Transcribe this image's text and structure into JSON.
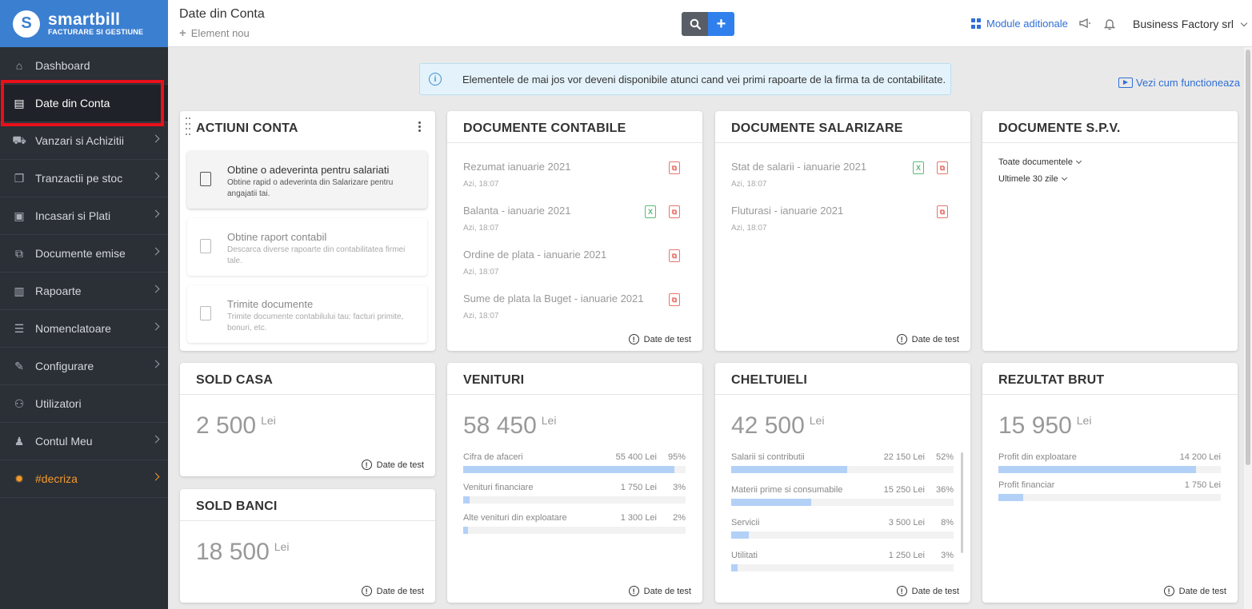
{
  "brand": {
    "name": "smartbill",
    "tagline": "FACTURARE SI GESTIUNE",
    "logo_letter": "S"
  },
  "colors": {
    "sidebar_bg": "#2b2f36",
    "brand_blue": "#3b7fd1",
    "accent": "#2f80ed",
    "highlight": "#e8101a",
    "decriza": "#f39a2b",
    "bar": "#b3d1f7"
  },
  "sidebar": {
    "items": [
      {
        "label": "Dashboard",
        "icon": "home-icon"
      },
      {
        "label": "Date din Conta",
        "icon": "book-icon",
        "active": true
      },
      {
        "label": "Vanzari si Achizitii",
        "icon": "cart-icon"
      },
      {
        "label": "Tranzactii pe stoc",
        "icon": "copy-icon"
      },
      {
        "label": "Incasari si Plati",
        "icon": "money-icon"
      },
      {
        "label": "Documente emise",
        "icon": "documents-icon"
      },
      {
        "label": "Rapoarte",
        "icon": "bar-chart-icon"
      },
      {
        "label": "Nomenclatoare",
        "icon": "list-icon"
      },
      {
        "label": "Configurare",
        "icon": "wrench-icon"
      },
      {
        "label": "Utilizatori",
        "icon": "users-icon"
      },
      {
        "label": "Contul Meu",
        "icon": "user-icon"
      },
      {
        "label": "#decriza",
        "icon": "lightbulb-icon"
      }
    ]
  },
  "header": {
    "title": "Date din Conta",
    "element_nou": "Element nou",
    "add_symbol": "+",
    "module_link": "Module aditionale",
    "company": "Business Factory srl"
  },
  "banner": {
    "info_glyph": "i",
    "text": "Elementele de mai jos vor deveni disponibile atunci cand vei primi rapoarte de la firma ta de contabilitate."
  },
  "vezi_link": "Vezi cum functioneaza",
  "test_label": "Date de test",
  "test_glyph": "!",
  "actiuni": {
    "title": "ACTIUNI CONTA",
    "items": [
      {
        "title": "Obtine o adeverinta pentru salariati",
        "desc": "Obtine rapid o adeverinta din Salarizare pentru angajatii tai."
      },
      {
        "title": "Obtine raport contabil",
        "desc": "Descarca diverse rapoarte din contabilitatea firmei tale."
      },
      {
        "title": "Trimite documente",
        "desc": "Trimite documente contabilului tau: facturi primite, bonuri, etc."
      }
    ]
  },
  "doc_contabile": {
    "title": "DOCUMENTE CONTABILE",
    "rows": [
      {
        "name": "Rezumat ianuarie 2021",
        "date": "Azi, 18:07",
        "xls": false
      },
      {
        "name": "Balanta - ianuarie 2021",
        "date": "Azi, 18:07",
        "xls": true
      },
      {
        "name": "Ordine de plata - ianuarie 2021",
        "date": "Azi, 18:07",
        "xls": false
      },
      {
        "name": "Sume de plata la Buget - ianuarie 2021",
        "date": "Azi, 18:07",
        "xls": false
      }
    ]
  },
  "doc_salarizare": {
    "title": "DOCUMENTE SALARIZARE",
    "rows": [
      {
        "name": "Stat de salarii - ianuarie 2021",
        "date": "Azi, 18:07",
        "xls": true
      },
      {
        "name": "Fluturasi - ianuarie 2021",
        "date": "Azi, 18:07",
        "xls": false
      }
    ]
  },
  "doc_spv": {
    "title": "DOCUMENTE S.P.V.",
    "filter1": "Toate documentele",
    "filter2": "Ultimele 30 zile"
  },
  "file_glyphs": {
    "pdf": "⧉",
    "xls": "X"
  },
  "sold_casa": {
    "title": "SOLD CASA",
    "amount": "2 500",
    "currency": "Lei"
  },
  "sold_banci": {
    "title": "SOLD BANCI",
    "amount": "18 500",
    "currency": "Lei"
  },
  "venituri": {
    "title": "VENITURI",
    "amount": "58 450",
    "currency": "Lei",
    "rows": [
      {
        "label": "Cifra de afaceri",
        "value": "55 400 Lei",
        "pct": "95%",
        "fill": 0.95
      },
      {
        "label": "Venituri financiare",
        "value": "1 750 Lei",
        "pct": "3%",
        "fill": 0.03
      },
      {
        "label": "Alte venituri din exploatare",
        "value": "1 300 Lei",
        "pct": "2%",
        "fill": 0.02
      }
    ]
  },
  "cheltuieli": {
    "title": "CHELTUIELI",
    "amount": "42 500",
    "currency": "Lei",
    "rows": [
      {
        "label": "Salarii si contributii",
        "value": "22 150 Lei",
        "pct": "52%",
        "fill": 0.52
      },
      {
        "label": "Materii prime si consumabile",
        "value": "15 250 Lei",
        "pct": "36%",
        "fill": 0.36
      },
      {
        "label": "Servicii",
        "value": "3 500 Lei",
        "pct": "8%",
        "fill": 0.08
      },
      {
        "label": "Utilitati",
        "value": "1 250 Lei",
        "pct": "3%",
        "fill": 0.03
      }
    ]
  },
  "rezultat": {
    "title": "REZULTAT BRUT",
    "amount": "15 950",
    "currency": "Lei",
    "rows": [
      {
        "label": "Profit din exploatare",
        "value": "14 200 Lei",
        "pct": "",
        "fill": 0.89
      },
      {
        "label": "Profit financiar",
        "value": "1 750 Lei",
        "pct": "",
        "fill": 0.11
      }
    ]
  }
}
